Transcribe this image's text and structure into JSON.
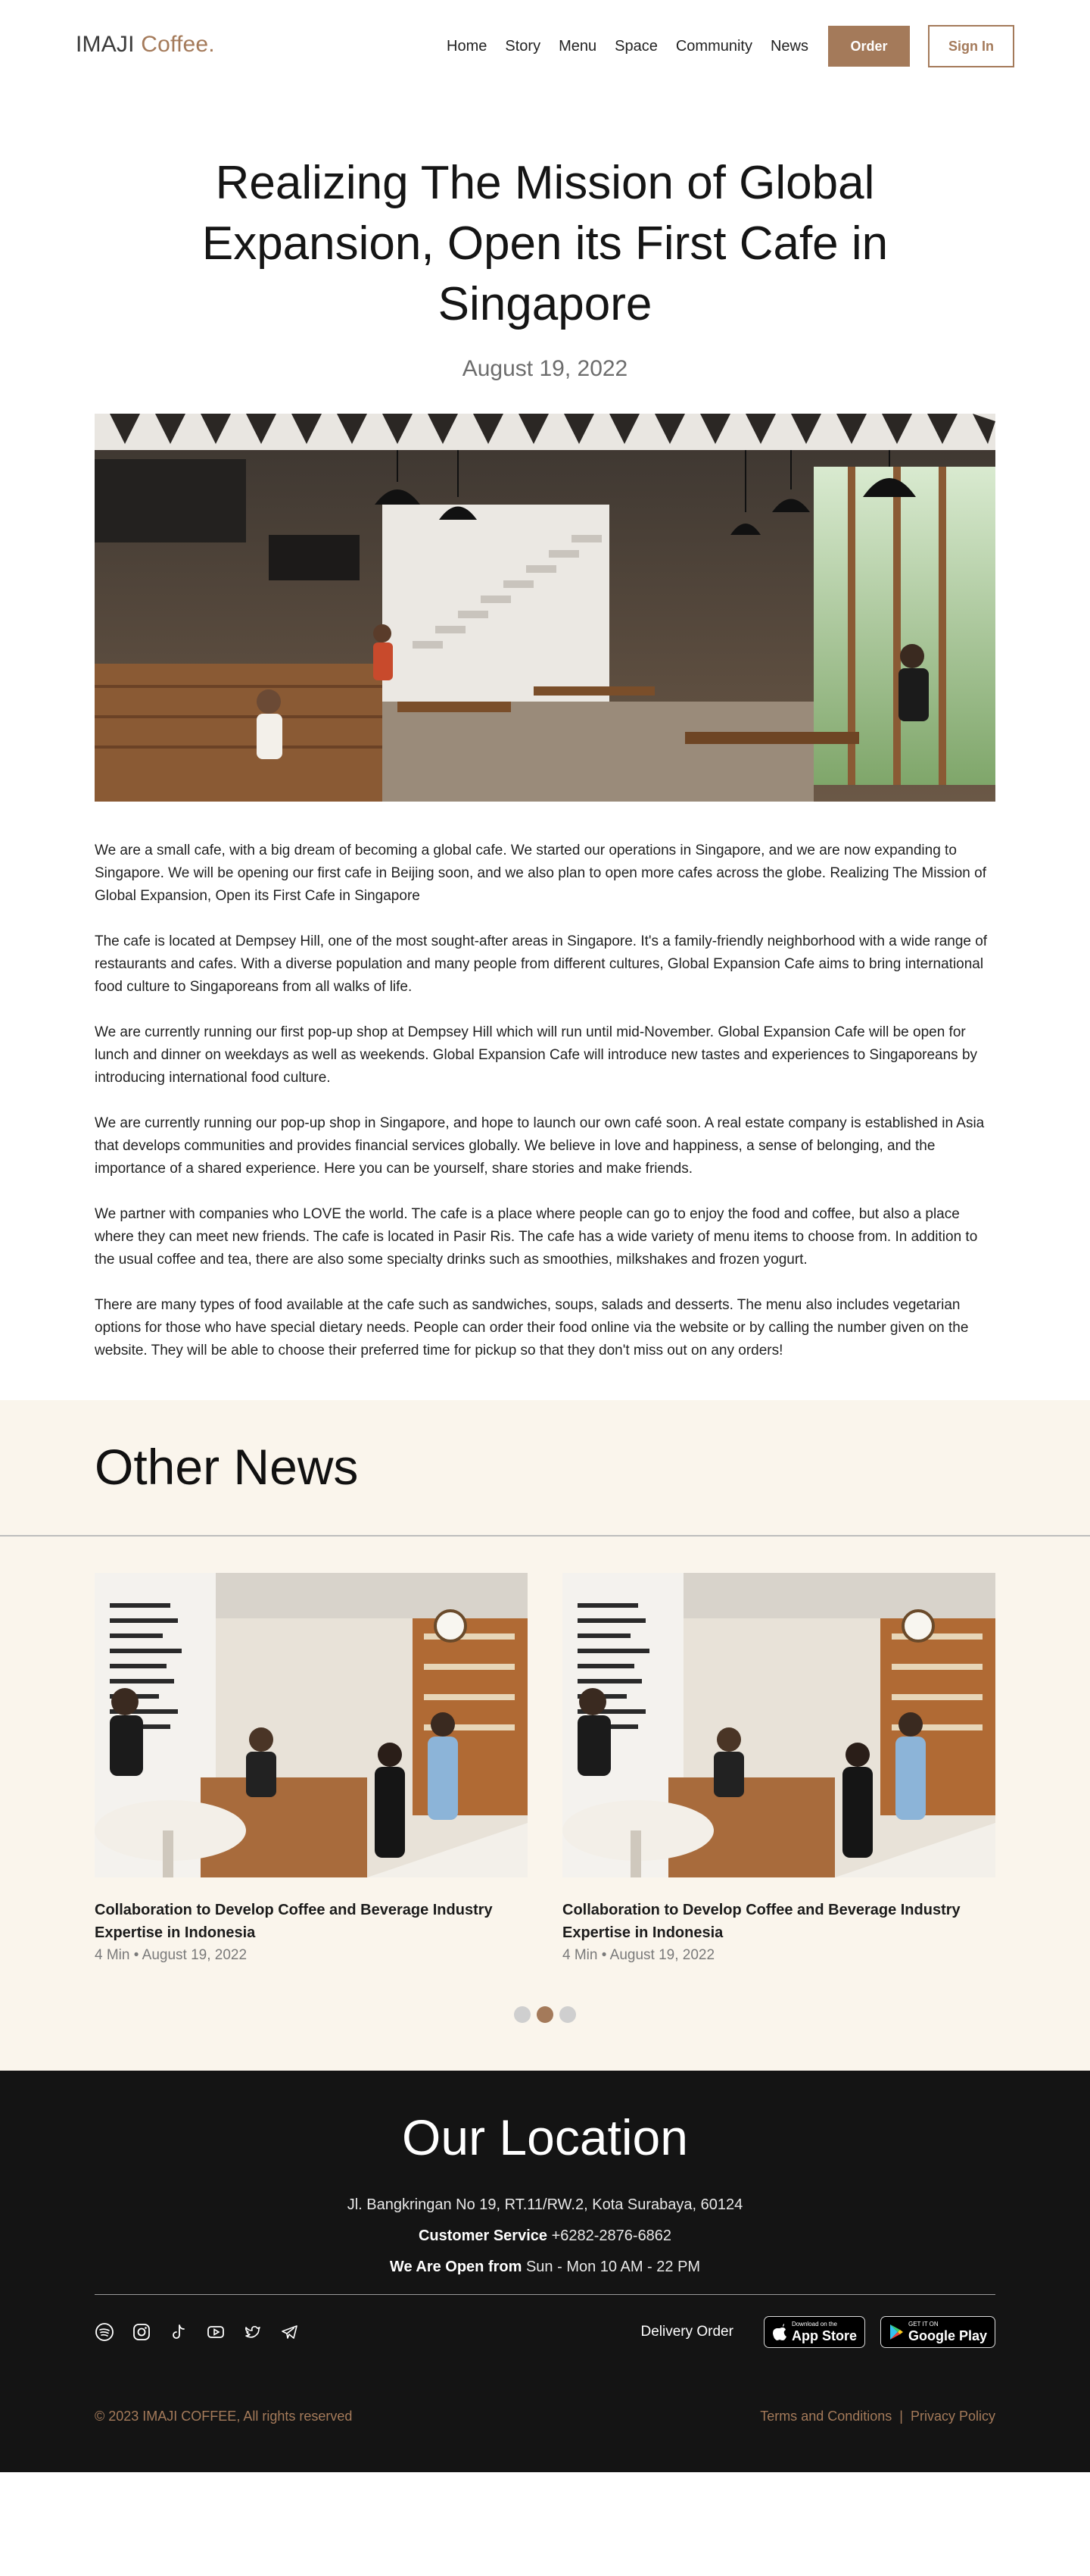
{
  "header": {
    "logo_main": "IMAJI",
    "logo_accent": "Coffee.",
    "nav": [
      "Home",
      "Story",
      "Menu",
      "Space",
      "Community",
      "News"
    ],
    "order_label": "Order",
    "signin_label": "Sign In"
  },
  "article": {
    "title": "Realizing The Mission of Global Expansion, Open its First Cafe in Singapore",
    "date": "August 19, 2022",
    "paragraphs": [
      "We are a small cafe, with a big dream of becoming a global cafe. We started our operations in Singapore, and we are now expanding to Singapore. We will be opening our first cafe in Beijing soon, and we also plan to open more cafes across the globe. Realizing The Mission of Global Expansion, Open its First Cafe in Singapore",
      "The cafe is located at Dempsey Hill, one of the most sought-after areas in Singapore. It's a family-friendly neighborhood with a wide range of restaurants and cafes. With a diverse population and many people from different cultures, Global Expansion Cafe aims to bring international food culture to Singaporeans from all walks of life.",
      "We are currently running our first pop-up shop at Dempsey Hill which will run until mid-November. Global Expansion Cafe will be open for lunch and dinner on weekdays as well as weekends. Global Expansion Cafe will introduce new tastes and experiences to Singaporeans by introducing international food culture.",
      "We are currently running our pop-up shop in Singapore, and hope to launch our own café soon. A real estate company is established in Asia that develops communities and provides financial services globally. We believe in love and happiness, a sense of belonging, and the importance of a shared experience. Here you can be yourself, share stories and make friends.",
      "We partner with companies who LOVE the world. The cafe is a place where people can go to enjoy the food and coffee, but also a place where they can meet new friends. The cafe is located in Pasir Ris. The cafe has a wide variety of menu items to choose from. In addition to the usual coffee and tea, there are also some specialty drinks such as smoothies, milkshakes and frozen yogurt.",
      "There are many types of food available at the cafe such as sandwiches, soups, salads and desserts. The menu also includes vegetarian options for those who have special dietary needs. People can order their food online via the website or by calling the number given on the website. They will be able to choose their preferred time for pickup so that they don't miss out on any orders!"
    ]
  },
  "other_news": {
    "heading": "Other News",
    "cards": [
      {
        "title": "Collaboration to Develop Coffee and Beverage Industry Expertise in Indonesia",
        "read_time": "4 Min",
        "date": "August 19, 2022"
      },
      {
        "title": "Collaboration to Develop Coffee and Beverage Industry Expertise in Indonesia",
        "read_time": "4 Min",
        "date": "August 19, 2022"
      }
    ],
    "bullet": "•",
    "active_dot": 1,
    "dot_count": 3
  },
  "footer": {
    "title": "Our Location",
    "address": "Jl. Bangkringan No 19, RT.11/RW.2, Kota Surabaya, 60124",
    "service_label": "Customer Service",
    "service_value": "+6282-2876-6862",
    "open_label": "We Are Open from",
    "open_value": "Sun - Mon 10 AM - 22 PM",
    "social_icons": [
      "spotify-icon",
      "instagram-icon",
      "tiktok-icon",
      "youtube-icon",
      "twitter-icon",
      "telegram-icon"
    ],
    "delivery_label": "Delivery Order",
    "appstore_small": "Download on the",
    "appstore_big": "App Store",
    "googleplay_small": "GET IT ON",
    "googleplay_big": "Google Play",
    "copyright": "© 2023 IMAJI COFFEE, All rights reserved",
    "terms": "Terms and Conditions",
    "separator": "|",
    "privacy": "Privacy Policy"
  },
  "colors": {
    "accent": "#a47a5a",
    "news_bg": "#faf5ec",
    "footer_bg": "#141414",
    "text": "#1b1b1b"
  }
}
